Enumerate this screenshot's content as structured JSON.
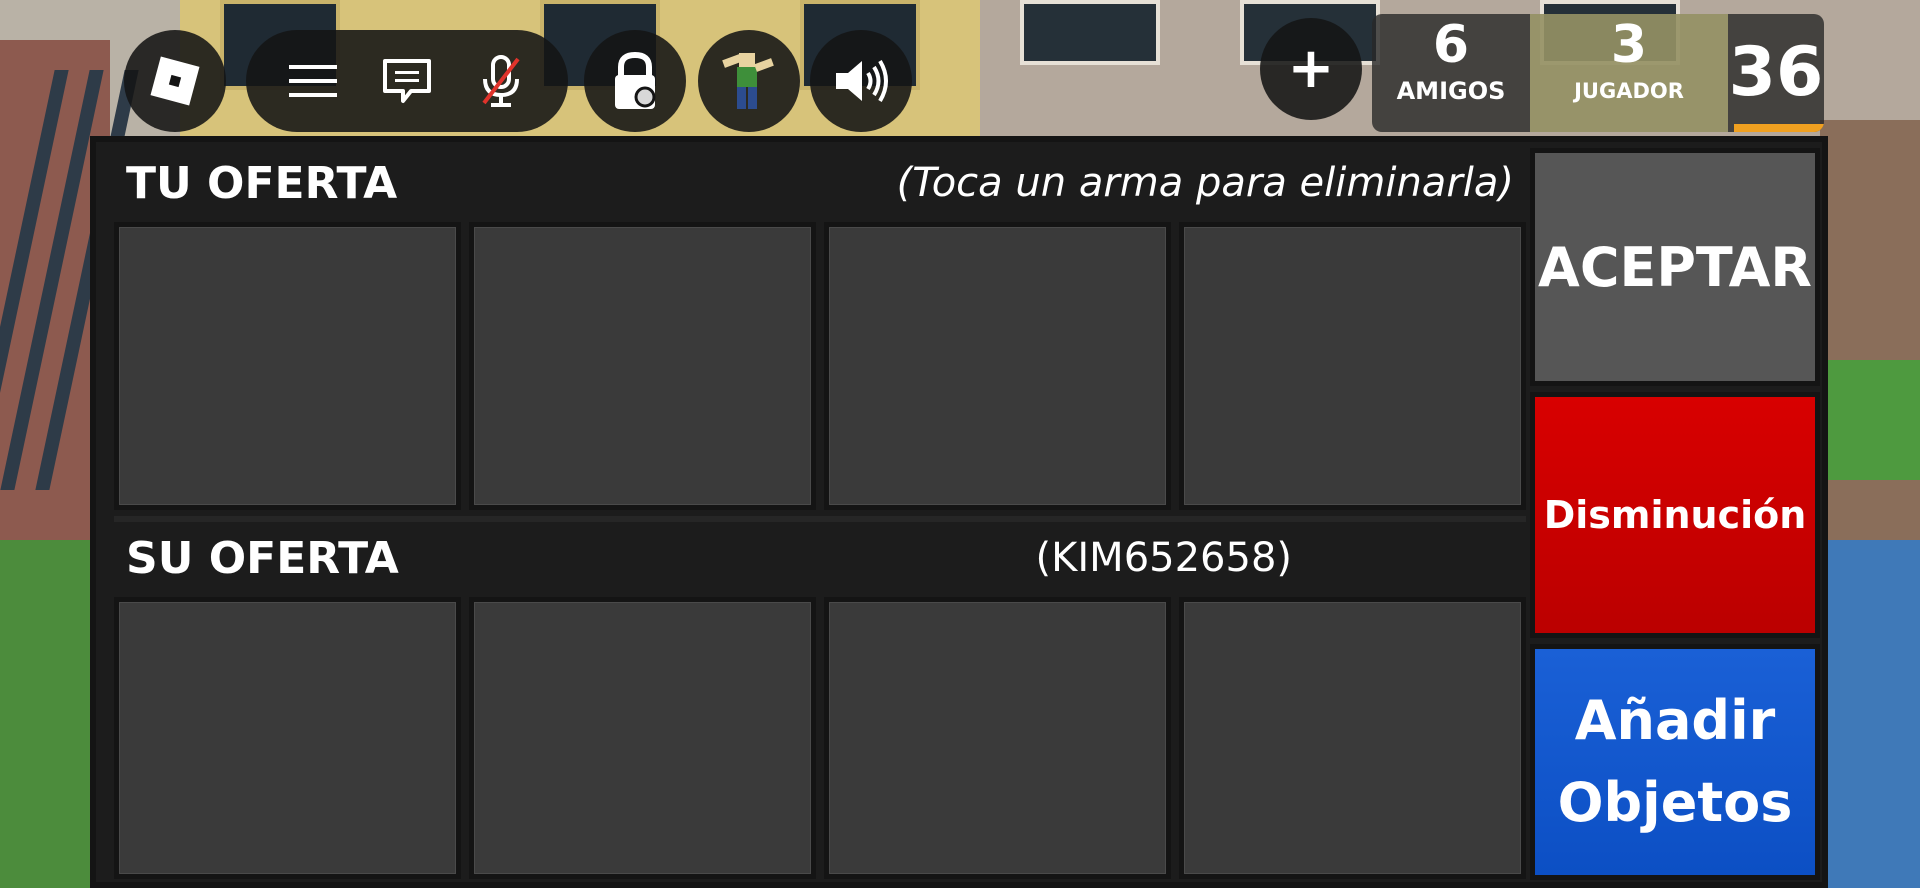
{
  "topbar": {
    "roblox_logo_icon": "roblox-logo-icon",
    "menu_icon": "menu-icon",
    "chat_icon": "chat-icon",
    "mic_muted_icon": "mic-muted-icon",
    "emote_lock_icon": "lock-icon",
    "avatar_icon": "avatar-icon",
    "volume_icon": "volume-icon",
    "plus_label": "+"
  },
  "stats": {
    "friends_count": "6",
    "friends_label": "AMIGOS",
    "players_count": "3",
    "players_label": "JUGADOR",
    "score": "36",
    "score_progress": 0.9
  },
  "trade": {
    "your_offer_title": "TU OFERTA",
    "your_offer_hint": "(Toca un arma para eliminarla)",
    "their_offer_title": "SU OFERTA",
    "partner_name": "(KIM652658)",
    "your_slots": [
      "",
      "",
      "",
      ""
    ],
    "their_slots": [
      "",
      "",
      "",
      ""
    ],
    "accept_label": "ACEPTAR",
    "decline_label": "Disminución",
    "add_items_label": "Añadir\nObjetos"
  },
  "colors": {
    "accept": "#565656",
    "decline": "#cc0000",
    "add_items": "#0c4fc4",
    "slot": "#3a3a3a"
  }
}
